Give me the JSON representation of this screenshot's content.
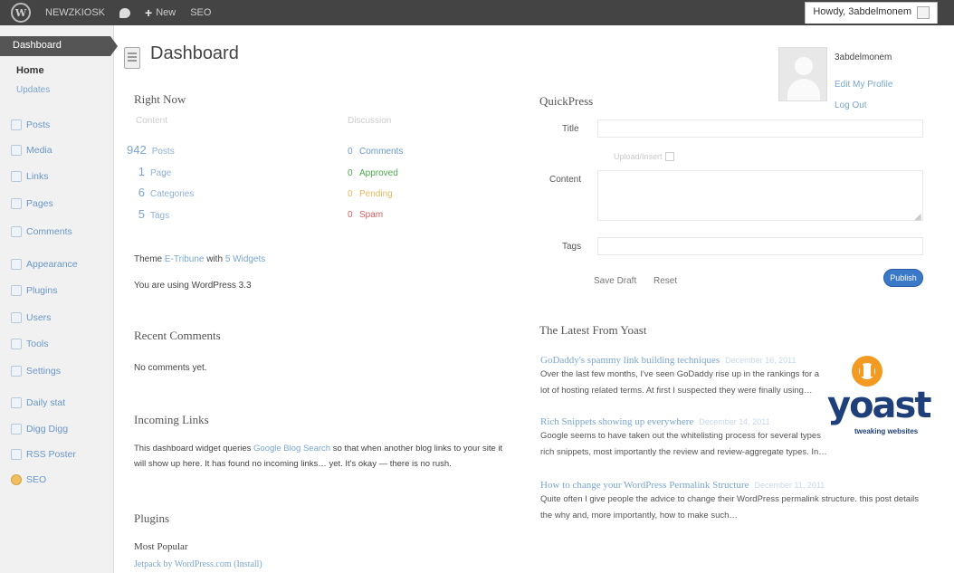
{
  "adminbar": {
    "site_name": "NEWZKIOSK",
    "new_label": "New",
    "seo_label": "SEO",
    "howdy": "Howdy, 3abdelmonem"
  },
  "sidebar": {
    "dashboard": "Dashboard",
    "home": "Home",
    "updates": "Updates",
    "items": [
      {
        "label": "Posts",
        "icon": "posts-icon"
      },
      {
        "label": "Media",
        "icon": "media-icon"
      },
      {
        "label": "Links",
        "icon": "links-icon"
      },
      {
        "label": "Pages",
        "icon": "pages-icon"
      },
      {
        "label": "Comments",
        "icon": "comments-icon"
      },
      {
        "label": "Appearance",
        "icon": "appearance-icon"
      },
      {
        "label": "Plugins",
        "icon": "plugins-icon"
      },
      {
        "label": "Users",
        "icon": "users-icon"
      },
      {
        "label": "Tools",
        "icon": "tools-icon"
      },
      {
        "label": "Settings",
        "icon": "settings-icon"
      },
      {
        "label": "Daily stat",
        "icon": "stats-icon"
      },
      {
        "label": "Digg Digg",
        "icon": "digg-icon"
      },
      {
        "label": "RSS Poster",
        "icon": "rss-icon"
      },
      {
        "label": "SEO",
        "icon": "yoast-seo-icon"
      }
    ]
  },
  "page_title": "Dashboard",
  "profile": {
    "name": "3abdelmonem",
    "edit": "Edit My Profile",
    "logout": "Log Out"
  },
  "right_now": {
    "title": "Right Now",
    "content_head": "Content",
    "discussion_head": "Discussion",
    "content": [
      {
        "num": "942",
        "label": "Posts"
      },
      {
        "num": "1",
        "label": "Page"
      },
      {
        "num": "6",
        "label": "Categories"
      },
      {
        "num": "5",
        "label": "Tags"
      }
    ],
    "discussion": [
      {
        "num": "0",
        "label": "Comments",
        "color": "#6a9ad0"
      },
      {
        "num": "0",
        "label": "Approved",
        "color": "#4caa4c"
      },
      {
        "num": "0",
        "label": "Pending",
        "color": "#e8b860"
      },
      {
        "num": "0",
        "label": "Spam",
        "color": "#d86060"
      }
    ],
    "theme_prefix": "Theme",
    "theme_name": "E-Tribune",
    "theme_with": "with",
    "widgets": "5 Widgets",
    "version": "You are using WordPress 3.3"
  },
  "recent_comments": {
    "title": "Recent Comments",
    "empty": "No comments yet."
  },
  "incoming_links": {
    "title": "Incoming Links",
    "text_before": "This dashboard widget queries",
    "link": "Google Blog Search",
    "text_after": "so that when another blog links to your site it",
    "line2": "will show up here. It has found no incoming links… yet. It's okay — there is no rush."
  },
  "plugins": {
    "title": "Plugins",
    "most_popular": "Most Popular",
    "plugin_name": "Jetpack by WordPress.com",
    "install": "(Install)"
  },
  "quickpress": {
    "title": "QuickPress",
    "title_label": "Title",
    "upload_label": "Upload/Insert",
    "content_label": "Content",
    "tags_label": "Tags",
    "save_draft": "Save Draft",
    "reset": "Reset",
    "publish": "Publish"
  },
  "yoast_feed": {
    "title": "The Latest From Yoast",
    "logo_text": "yoast",
    "logo_tagline": "tweaking websites",
    "items": [
      {
        "title": "GoDaddy's spammy link building techniques",
        "date": "December 16, 2011",
        "excerpt1": "Over the last few months, I've seen GoDaddy rise up in the rankings for a",
        "excerpt2": "lot of hosting related terms. At first I suspected they were finally using…"
      },
      {
        "title": "Rich Snippets showing up everywhere",
        "date": "December 14, 2011",
        "excerpt1": "Google seems to have taken out the whitelisting process for several types",
        "excerpt2": "rich snippets, most importantly the review and review-aggregate types. In…"
      },
      {
        "title": "How to change your WordPress Permalink Structure",
        "date": "December 11, 2011",
        "excerpt1": "Quite often I give people the advice to change their WordPress permalink structure. this post details",
        "excerpt2": "the why and, more importantly, how to make such…"
      }
    ]
  }
}
